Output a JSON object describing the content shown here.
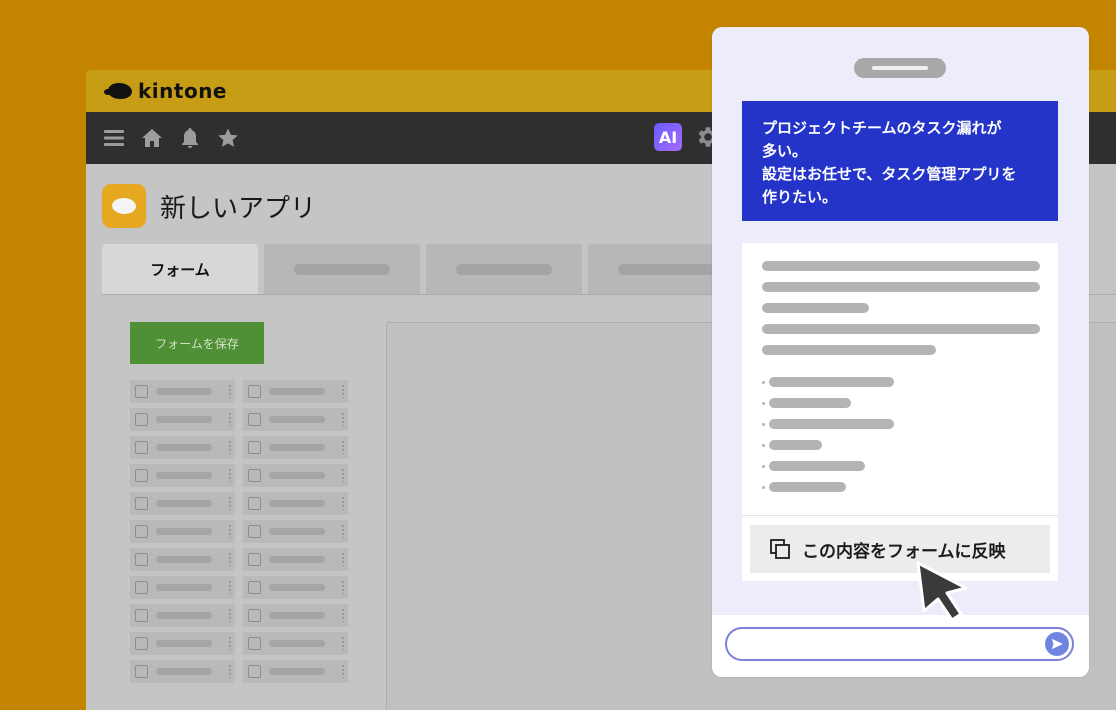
{
  "app": {
    "brand": "kintone",
    "ai_badge": "AI",
    "title": "新しいアプリ"
  },
  "tabs": {
    "form": "フォーム"
  },
  "form": {
    "save_label": "フォームを保存"
  },
  "chat": {
    "user_message": "プロジェクトチームのタスク漏れが\n多い。\n設定はお任せで、タスク管理アプリを\n作りたい。",
    "reflect_label": "この内容をフォームに反映",
    "input_value": ""
  },
  "colors": {
    "background": "#c38500",
    "user_bubble": "#2434c8",
    "brand_bar": "#c69d14",
    "save_button": "#4f8f35",
    "panel": "#ececfb"
  },
  "icons": [
    "menu-icon",
    "home-icon",
    "bell-icon",
    "star-icon",
    "gear-icon",
    "copy-icon",
    "send-icon",
    "cursor-pointer-icon"
  ]
}
